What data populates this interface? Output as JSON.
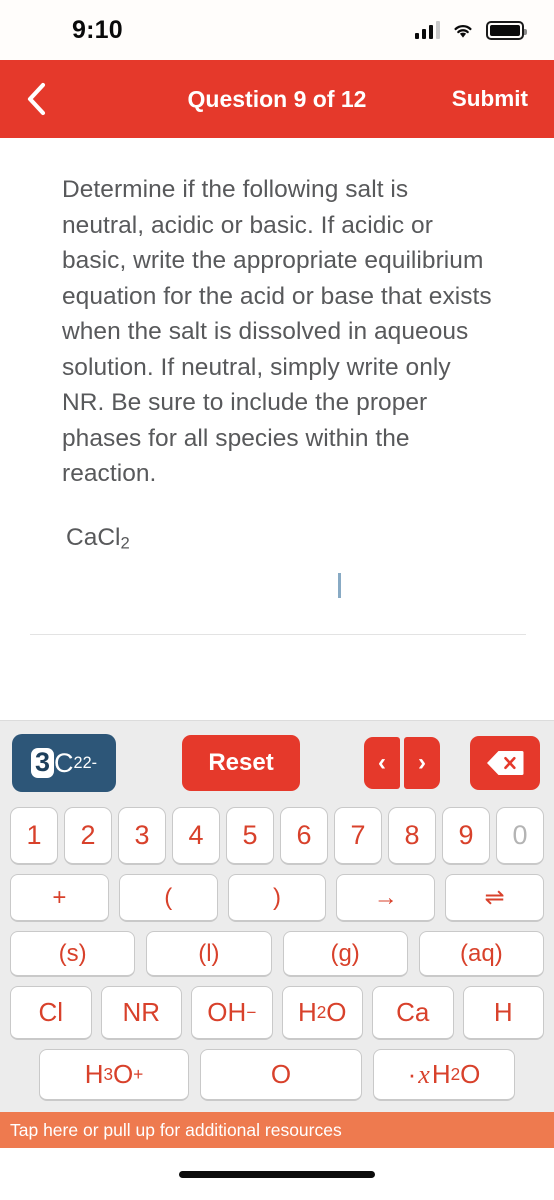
{
  "status_bar": {
    "time": "9:10",
    "signal_icon": "cellular-signal-icon",
    "wifi_icon": "wifi-icon",
    "battery_icon": "battery-full-icon"
  },
  "nav_bar": {
    "back_icon": "chevron-left-icon",
    "title": "Question 9 of 12",
    "submit_label": "Submit",
    "background_color": "#e5392b"
  },
  "question": {
    "prompt": "Determine if the following salt is neutral, acidic or basic. If acidic or basic, write the appropriate equilibrium equation for the acid or base that exists when the salt is dissolved in aqueous solution. If neutral, simply write only NR. Be sure to include the proper phases for all species within the reaction.",
    "formula_prefix": "CaCl",
    "formula_sub": "2",
    "answer_value": ""
  },
  "keypad": {
    "background_color": "#ececec",
    "token_chip": {
      "highlight": "3",
      "element": "C",
      "subscript": "2",
      "superscript": "2-",
      "color": "#2d5678"
    },
    "reset_label": "Reset",
    "prev_label": "‹",
    "next_label": "›",
    "backspace_icon": "backspace-delete-icon",
    "accent_color": "#e5392b",
    "key_text_color": "#d8412b",
    "number_row": [
      {
        "label": "1",
        "disabled": false
      },
      {
        "label": "2",
        "disabled": false
      },
      {
        "label": "3",
        "disabled": false
      },
      {
        "label": "4",
        "disabled": false
      },
      {
        "label": "5",
        "disabled": false
      },
      {
        "label": "6",
        "disabled": false
      },
      {
        "label": "7",
        "disabled": false
      },
      {
        "label": "8",
        "disabled": false
      },
      {
        "label": "9",
        "disabled": false
      },
      {
        "label": "0",
        "disabled": true
      }
    ],
    "operator_row": [
      "+",
      "(",
      ")",
      "→",
      "⇌"
    ],
    "phase_row": [
      "(s)",
      "(l)",
      "(g)",
      "(aq)"
    ],
    "species_row": [
      {
        "base": "Cl",
        "sub": "",
        "sup": ""
      },
      {
        "base": "NR",
        "sub": "",
        "sup": ""
      },
      {
        "base": "OH",
        "sub": "",
        "sup": "−"
      },
      {
        "base": "H",
        "sub": "2",
        "sup": "",
        "tail": "O"
      },
      {
        "base": "Ca",
        "sub": "",
        "sup": ""
      },
      {
        "base": "H",
        "sub": "",
        "sup": ""
      }
    ],
    "last_row": {
      "hydronium_base": "H",
      "hydronium_sub": "3",
      "hydronium_tail": "O",
      "hydronium_sup": "+",
      "oxygen": "O",
      "hydrate_dot": "·",
      "hydrate_var": "x",
      "hydrate_base": "H",
      "hydrate_sub": "2",
      "hydrate_tail": "O"
    }
  },
  "resource_banner": {
    "label": "Tap here or pull up for additional resources",
    "background_color": "#ee7a4f"
  },
  "home_indicator": {
    "name": "home-indicator"
  }
}
